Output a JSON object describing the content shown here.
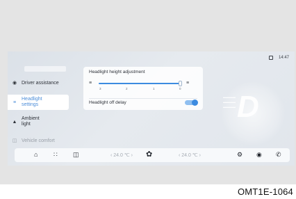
{
  "status": {
    "time": "14:47",
    "icon": "battery-icon"
  },
  "sidebar": {
    "items": [
      {
        "label": "Driver assistance",
        "icon": "steering-wheel-icon"
      },
      {
        "label": "Headlight settings",
        "icon": "headlight-icon",
        "active": true
      },
      {
        "label": "Ambient light",
        "icon": "ambient-light-icon"
      },
      {
        "label": "Vehicle comfort",
        "icon": "seat-icon"
      }
    ]
  },
  "headlight": {
    "title": "Headlight height adjustment",
    "ticks": [
      "3",
      "2",
      "1",
      "0"
    ],
    "level": 0,
    "delay_label": "Headlight off delay",
    "delay_on": true
  },
  "bottom_bar": {
    "left_temp": "24.0",
    "right_temp": "24.0",
    "icons": [
      "home-icon",
      "apps-icon",
      "car-icon",
      "fan-icon",
      "settings-icon",
      "media-icon",
      "phone-icon"
    ]
  },
  "footer": {
    "code": "OMT1E-1064"
  },
  "colors": {
    "accent": "#3c8be0",
    "screen_bg": "#e3e7ec"
  }
}
